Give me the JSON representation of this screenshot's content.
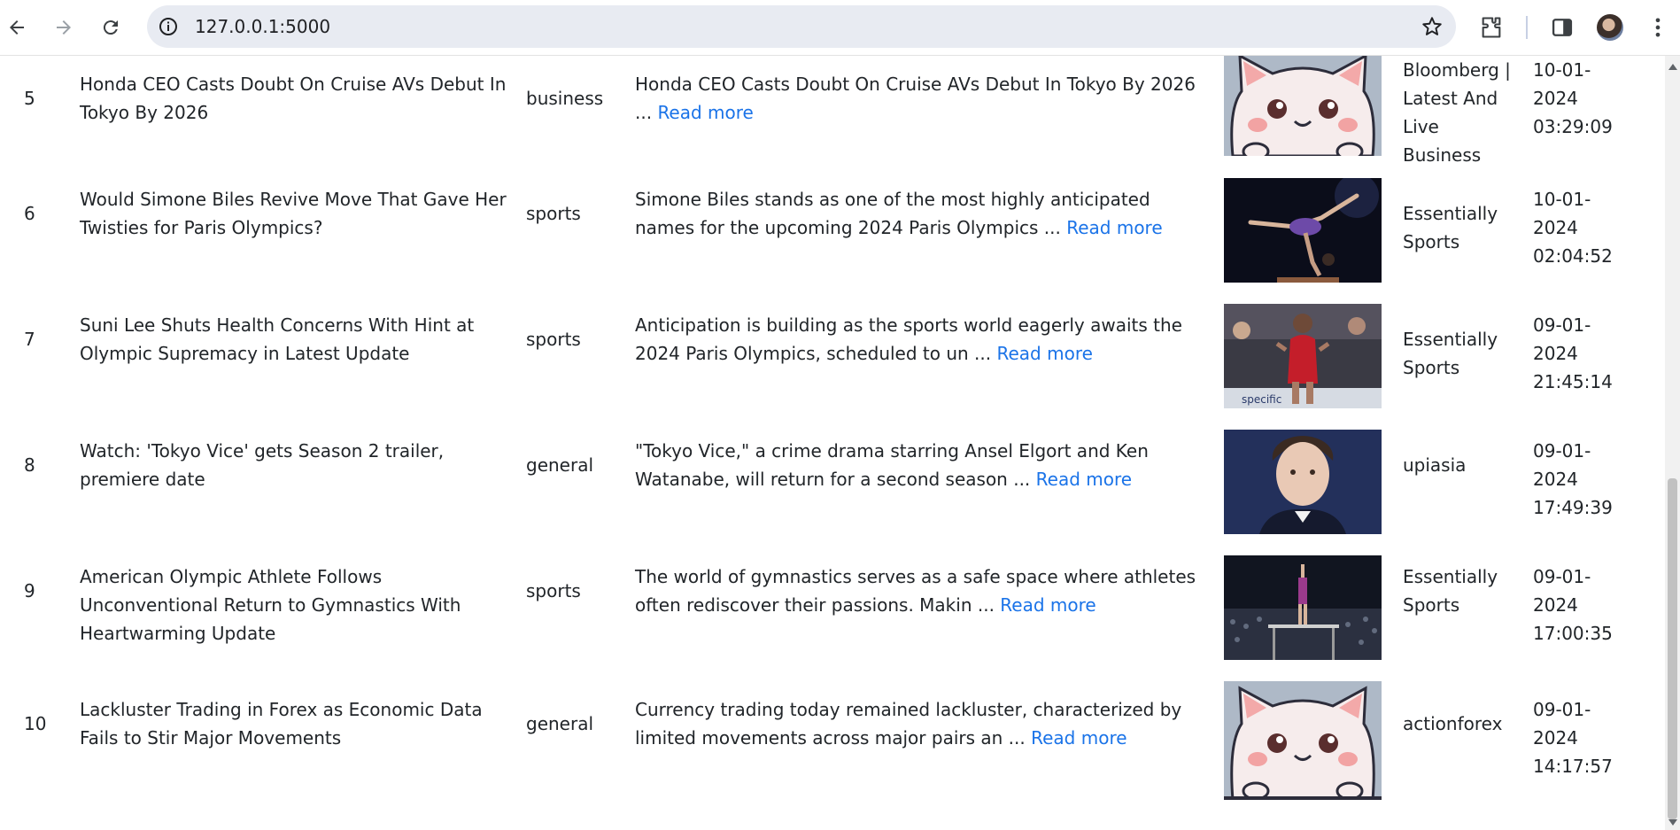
{
  "browser": {
    "url": "127.0.0.1:5000"
  },
  "articles": [
    {
      "index": "5",
      "title": "Honda CEO Casts Doubt On Cruise AVs Debut In Tokyo By 2026",
      "category": "business",
      "description": "Honda CEO Casts Doubt On Cruise AVs Debut In Tokyo By 2026 ...",
      "read_more": "Read more",
      "image": "cat-placeholder",
      "source": "Bloomberg | Latest And Live Business",
      "date": "10-01-2024",
      "time": "03:29:09"
    },
    {
      "index": "6",
      "title": "Would Simone Biles Revive Move That Gave Her Twisties for Paris Olympics?",
      "category": "sports",
      "description": "Simone Biles stands as one of the most highly anticipated names for the upcoming 2024 Paris Olympics ...",
      "read_more": "Read more",
      "image": "gymnast-beam-photo",
      "source": "Essentially Sports",
      "date": "10-01-2024",
      "time": "02:04:52"
    },
    {
      "index": "7",
      "title": "Suni Lee Shuts Health Concerns With Hint at Olympic Supremacy in Latest Update",
      "category": "sports",
      "description": "Anticipation is building as the sports world eagerly awaits the 2024 Paris Olympics, scheduled to un ...",
      "read_more": "Read more",
      "image": "gymnast-red-leotard-photo",
      "source": "Essentially Sports",
      "date": "09-01-2024",
      "time": "21:45:14"
    },
    {
      "index": "8",
      "title": "Watch: 'Tokyo Vice' gets Season 2 trailer, premiere date",
      "category": "general",
      "description": "\"Tokyo Vice,\" a crime drama starring Ansel Elgort and Ken Watanabe, will return for a second season ...",
      "read_more": "Read more",
      "image": "actor-portrait-photo",
      "source": "upiasia",
      "date": "09-01-2024",
      "time": "17:49:39"
    },
    {
      "index": "9",
      "title": "American Olympic Athlete Follows Unconventional Return to Gymnastics With Heartwarming Update",
      "category": "sports",
      "description": "The world of gymnastics serves as a safe space where athletes often rediscover their passions. Makin ...",
      "read_more": "Read more",
      "image": "gymnast-bars-photo",
      "source": "Essentially Sports",
      "date": "09-01-2024",
      "time": "17:00:35"
    },
    {
      "index": "10",
      "title": "Lackluster Trading in Forex as Economic Data Fails to Stir Major Movements",
      "category": "general",
      "description": "Currency trading today remained lackluster, characterized by limited movements across major pairs an ...",
      "read_more": "Read more",
      "image": "cat-placeholder",
      "source": "actionforex",
      "date": "09-01-2024",
      "time": "14:17:57"
    }
  ],
  "colors": {
    "link": "#1a73e8",
    "text": "#212529",
    "omnibox": "#e8ebf2"
  }
}
